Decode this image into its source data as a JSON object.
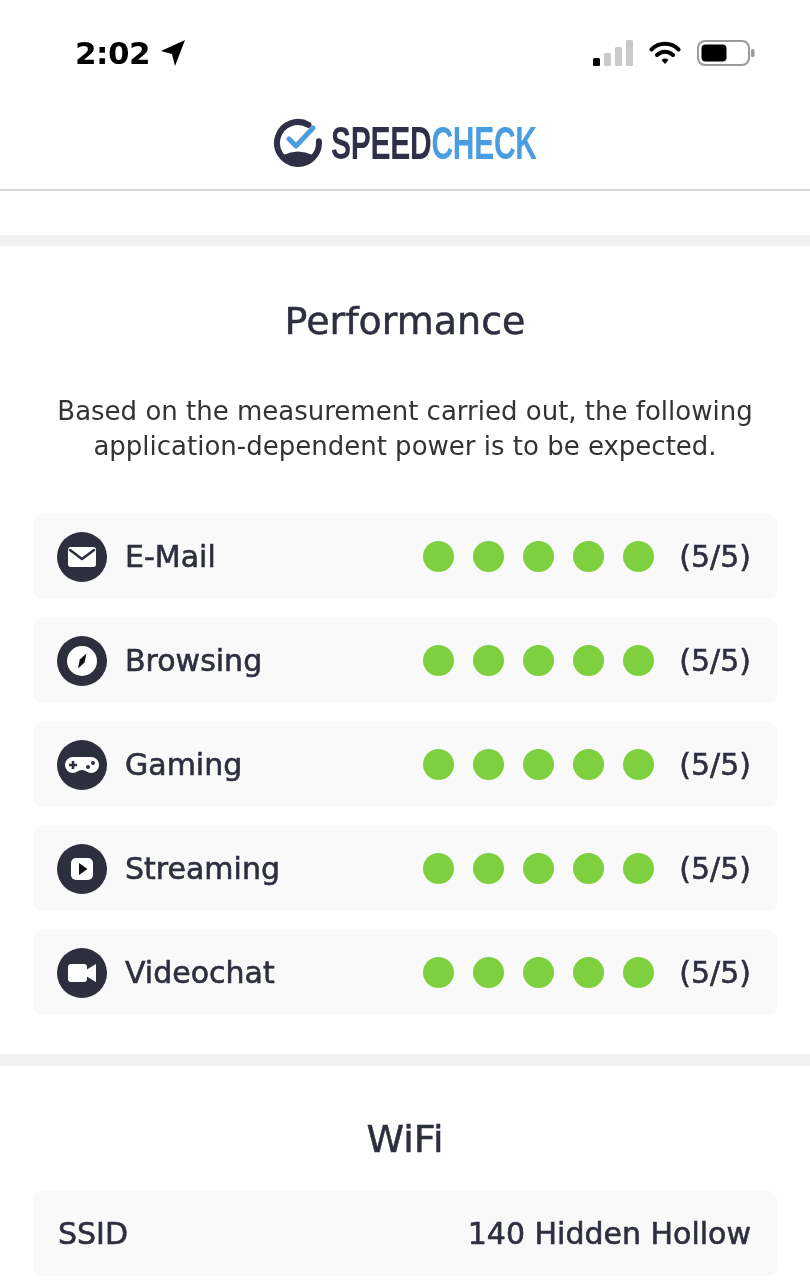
{
  "status_bar": {
    "time": "2:02"
  },
  "header": {
    "logo": {
      "primary": "SPEED",
      "accent": "CHECK"
    }
  },
  "performance": {
    "title": "Performance",
    "description": "Based on the measurement carried out, the following application-dependent power is to be expected.",
    "items": [
      {
        "label": "E-Mail",
        "stars": 5,
        "rating": "(5/5)"
      },
      {
        "label": "Browsing",
        "stars": 5,
        "rating": "(5/5)"
      },
      {
        "label": "Gaming",
        "stars": 5,
        "rating": "(5/5)"
      },
      {
        "label": "Streaming",
        "stars": 5,
        "rating": "(5/5)"
      },
      {
        "label": "Videochat",
        "stars": 5,
        "rating": "(5/5)"
      }
    ]
  },
  "wifi": {
    "title": "WiFi",
    "rows": [
      {
        "label": "SSID",
        "value": "140 Hidden Hollow"
      }
    ]
  }
}
